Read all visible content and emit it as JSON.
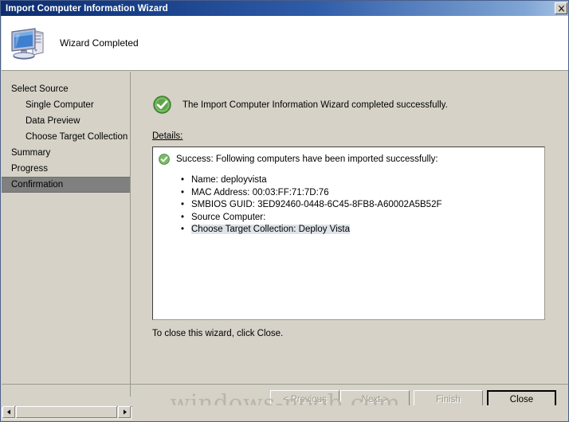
{
  "window": {
    "title": "Import Computer Information Wizard",
    "close_icon": "close-x-icon"
  },
  "header": {
    "icon": "computer-icon",
    "title": "Wizard Completed"
  },
  "sidebar": {
    "items": [
      {
        "label": "Select Source",
        "level": 0,
        "selected": false
      },
      {
        "label": "Single Computer",
        "level": 1,
        "selected": false
      },
      {
        "label": "Data Preview",
        "level": 1,
        "selected": false
      },
      {
        "label": "Choose Target Collection",
        "level": 1,
        "selected": false
      },
      {
        "label": "Summary",
        "level": 0,
        "selected": false
      },
      {
        "label": "Progress",
        "level": 0,
        "selected": false
      },
      {
        "label": "Confirmation",
        "level": 0,
        "selected": true
      }
    ]
  },
  "content": {
    "status_icon": "success-check-icon",
    "status_text": "The Import Computer Information Wizard completed successfully.",
    "details_label": "Details:",
    "details": {
      "icon": "success-check-icon",
      "heading": "Success: Following computers have been imported successfully:",
      "bullets": [
        {
          "text": "Name: deployvista",
          "highlighted": false
        },
        {
          "text": "MAC Address: 00:03:FF:71:7D:76",
          "highlighted": false
        },
        {
          "text": "SMBIOS GUID: 3ED92460-0448-6C45-8FB8-A60002A5B52F",
          "highlighted": false
        },
        {
          "text": "Source Computer:",
          "highlighted": false
        },
        {
          "text": "Choose Target Collection: Deploy Vista",
          "highlighted": true
        }
      ]
    },
    "closing_note": "To close this wizard, click Close."
  },
  "footer": {
    "buttons": [
      {
        "name": "previous",
        "label": "< Previous",
        "enabled": false,
        "default": false
      },
      {
        "name": "next",
        "label": "Next >",
        "enabled": false,
        "default": false
      },
      {
        "name": "finish",
        "label": "Finish",
        "enabled": false,
        "default": false
      },
      {
        "name": "close",
        "label": "Close",
        "enabled": true,
        "default": true
      }
    ]
  },
  "watermark": {
    "text": "windows-noob.com"
  },
  "scrollbar": {
    "left_arrow_icon": "arrow-left-icon",
    "right_arrow_icon": "arrow-right-icon",
    "thumb": "scroll-thumb"
  },
  "colors": {
    "titlebar_start": "#0d2e6e",
    "titlebar_end": "#a8c4e4",
    "dialog_face": "#d6d2c8",
    "selection_gray": "#808080",
    "success_green": "#4e9a3e",
    "highlight_blue": "#dfe4ea"
  }
}
